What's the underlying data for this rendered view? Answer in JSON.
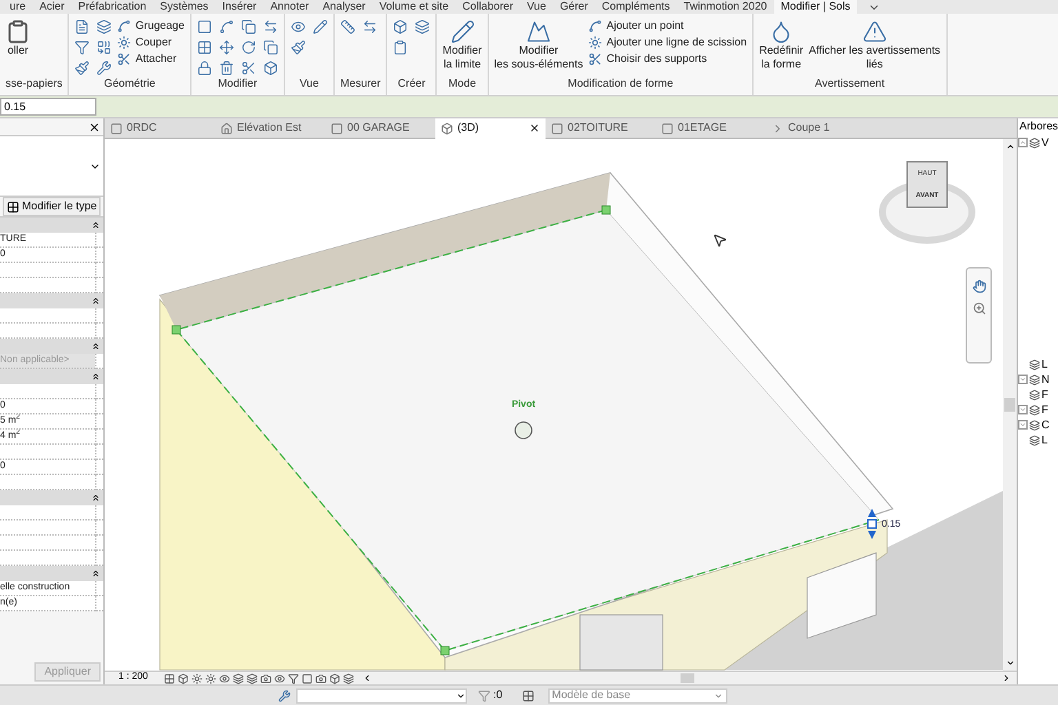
{
  "menu_tabs": [
    {
      "label": "ure",
      "selected": false
    },
    {
      "label": "Acier",
      "selected": false
    },
    {
      "label": "Préfabrication",
      "selected": false
    },
    {
      "label": "Systèmes",
      "selected": false
    },
    {
      "label": "Insérer",
      "selected": false
    },
    {
      "label": "Annoter",
      "selected": false
    },
    {
      "label": "Analyser",
      "selected": false
    },
    {
      "label": "Volume et site",
      "selected": false
    },
    {
      "label": "Collaborer",
      "selected": false
    },
    {
      "label": "Vue",
      "selected": false
    },
    {
      "label": "Gérer",
      "selected": false
    },
    {
      "label": "Compléments",
      "selected": false
    },
    {
      "label": "Twinmotion 2020",
      "selected": false
    },
    {
      "label": "Modifier | Sols",
      "selected": true
    }
  ],
  "ribbon": {
    "panels": [
      {
        "kind": "clipboard",
        "title": "sse-papiers",
        "buttons": [
          "oller"
        ]
      },
      {
        "kind": "geometry",
        "title": "Géométrie",
        "tools": [
          "Grugeage",
          "Couper",
          "Attacher"
        ]
      },
      {
        "kind": "modify",
        "title": "Modifier"
      },
      {
        "kind": "view",
        "title": "Vue"
      },
      {
        "kind": "measure",
        "title": "Mesurer"
      },
      {
        "kind": "create",
        "title": "Créer"
      },
      {
        "kind": "mode",
        "title": "Mode",
        "buttons": [
          "Modifier\nla limite"
        ]
      },
      {
        "kind": "shape",
        "title": "Modification de forme",
        "buttons": [
          "Modifier\nles sous-éléments"
        ],
        "tools": [
          "Ajouter un point",
          "Ajouter une ligne de scission",
          "Choisir des supports"
        ]
      },
      {
        "kind": "warning",
        "title": "Avertissement",
        "buttons": [
          "Redéfinir\nla forme",
          "Afficher les avertissements\nliés"
        ]
      }
    ]
  },
  "options_bar": {
    "value": "0.15"
  },
  "properties": {
    "type_button": "Modifier le type",
    "groups": [
      {
        "rows": [
          {
            "value": "TURE",
            "readonly": false
          },
          {
            "value": "0",
            "readonly": false
          },
          {
            "readonly": false
          },
          {
            "readonly": false
          }
        ]
      },
      {
        "rows": [
          {
            "readonly": false
          },
          {
            "readonly": false
          }
        ]
      },
      {
        "rows": [
          {
            "value": "Non applicable>",
            "readonly": true
          }
        ]
      },
      {
        "rows": [
          {
            "readonly": false
          },
          {
            "value": "0",
            "readonly": false
          },
          {
            "value": "5 m$^{2}$",
            "readonly": false
          },
          {
            "value": "4 m$^{2}$",
            "readonly": false
          },
          {
            "readonly": false
          },
          {
            "value": "0",
            "readonly": false
          },
          {
            "readonly": false
          }
        ]
      },
      {
        "rows": [
          {
            "readonly": false
          },
          {
            "readonly": false
          },
          {
            "readonly": false
          },
          {
            "readonly": false
          }
        ]
      },
      {
        "rows": [
          {
            "value": "elle construction",
            "readonly": false
          },
          {
            "value": "n(e)",
            "readonly": false
          }
        ]
      }
    ],
    "apply_button": "Appliquer"
  },
  "view_tabs": [
    {
      "label": "0RDC",
      "kind": "plan",
      "selected": false,
      "closable": false
    },
    {
      "label": "Elévation Est",
      "kind": "elevation",
      "selected": false,
      "closable": false
    },
    {
      "label": "00 GARAGE",
      "kind": "plan",
      "selected": false,
      "closable": false
    },
    {
      "label": "(3D)",
      "kind": "perspective",
      "selected": true,
      "closable": true
    },
    {
      "label": "02TOITURE",
      "kind": "plan",
      "selected": false,
      "closable": false
    },
    {
      "label": "01ETAGE",
      "kind": "plan",
      "selected": false,
      "closable": false
    },
    {
      "label": "Coupe 1",
      "kind": "section",
      "selected": false,
      "closable": false
    }
  ],
  "viewport": {
    "pivot_label": "Pivot",
    "dimension": "0.15",
    "viewcube": {
      "top": "HAUT",
      "front": "AVANT"
    }
  },
  "view_bar": {
    "scale": "1 : 200"
  },
  "project_browser": {
    "title": "Arbores",
    "items": [
      {
        "label": "V",
        "expanded": true
      },
      {
        "label": "L"
      },
      {
        "label": "N",
        "expanded": false
      },
      {
        "label": "F"
      },
      {
        "label": "F",
        "expanded": false
      },
      {
        "label": "C",
        "expanded": false
      },
      {
        "label": "L"
      }
    ]
  },
  "status_bar": {
    "count": ":0",
    "model": "Modèle de base"
  }
}
